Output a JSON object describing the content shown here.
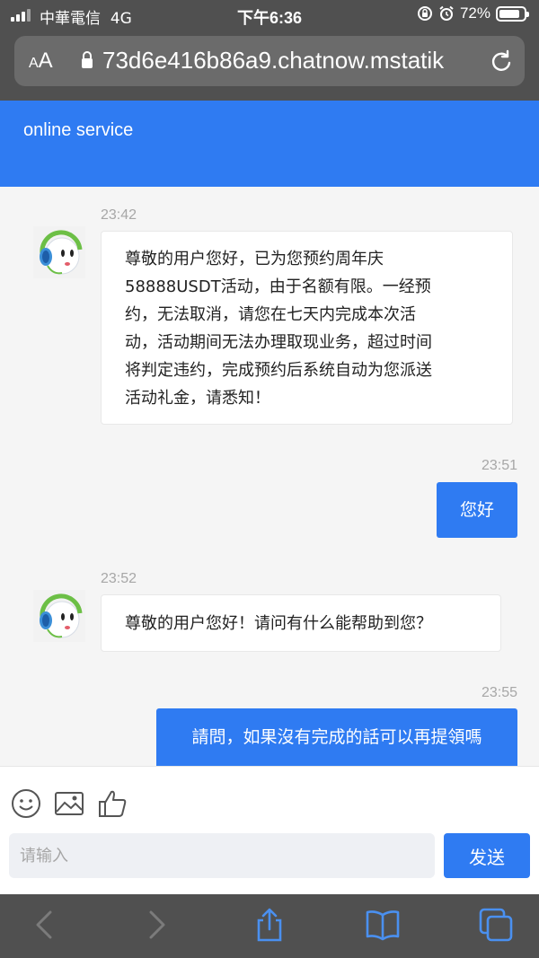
{
  "status_bar": {
    "carrier": "中華電信",
    "network": "4G",
    "time": "下午6:36",
    "battery": "72%",
    "battery_level": 0.72
  },
  "browser": {
    "text_size_label": "AA",
    "url": "73d6e416b86a9.chatnow.mstatik"
  },
  "header": {
    "title": "online service"
  },
  "messages": [
    {
      "side": "in",
      "time": "23:42",
      "lines": [
        "尊敬的用户您好，已为您预约周年庆",
        "58888USDT活动，由于名额有限。一经预",
        "约，无法取消，请您在七天内完成本次活",
        "动，活动期间无法办理取现业务，超过时间",
        "将判定违约，完成预约后系统自动为您派送",
        "活动礼金，请悉知！"
      ]
    },
    {
      "side": "out",
      "time": "23:51",
      "text": "您好"
    },
    {
      "side": "in",
      "time": "23:52",
      "lines": [
        "尊敬的用户您好！请问有什么能帮助到您？"
      ]
    },
    {
      "side": "out",
      "time": "23:55",
      "text": "請問，如果沒有完成的話可以再提領嗎"
    }
  ],
  "composer": {
    "placeholder": "请输入",
    "send_label": "发送",
    "tools": [
      "emoji-icon",
      "image-icon",
      "thumbs-up-icon"
    ]
  },
  "toolbar": {
    "icons": [
      "back-icon",
      "forward-icon",
      "share-icon",
      "bookmarks-icon",
      "tabs-icon"
    ]
  },
  "colors": {
    "accent": "#2f7bf2",
    "browser_chrome": "#505050",
    "safari_blue": "#4a90f0"
  }
}
